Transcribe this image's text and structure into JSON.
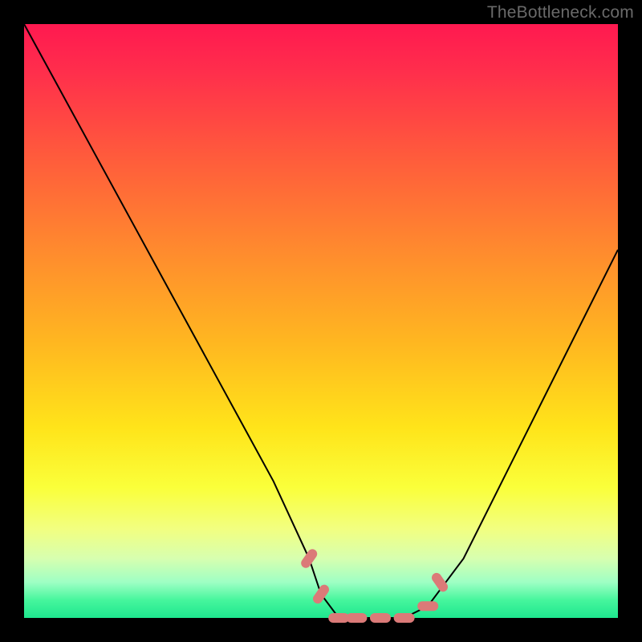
{
  "watermark": "TheBottleneck.com",
  "chart_data": {
    "type": "line",
    "title": "",
    "xlabel": "",
    "ylabel": "",
    "xlim": [
      0,
      1
    ],
    "ylim": [
      0,
      1
    ],
    "series": [
      {
        "name": "bottleneck-curve",
        "x": [
          0.0,
          0.06,
          0.12,
          0.18,
          0.24,
          0.3,
          0.36,
          0.42,
          0.48,
          0.5,
          0.53,
          0.56,
          0.6,
          0.64,
          0.68,
          0.74,
          0.8,
          0.86,
          0.92,
          1.0
        ],
        "values": [
          1.0,
          0.89,
          0.78,
          0.67,
          0.56,
          0.45,
          0.34,
          0.23,
          0.1,
          0.04,
          0.0,
          0.0,
          0.0,
          0.0,
          0.02,
          0.1,
          0.22,
          0.34,
          0.46,
          0.62
        ]
      },
      {
        "name": "highlight-markers",
        "x": [
          0.48,
          0.5,
          0.53,
          0.56,
          0.6,
          0.64,
          0.68,
          0.7
        ],
        "values": [
          0.1,
          0.04,
          0.0,
          0.0,
          0.0,
          0.0,
          0.02,
          0.06
        ]
      }
    ],
    "colors": {
      "curve": "#000000",
      "markers": "#db7a78"
    }
  }
}
